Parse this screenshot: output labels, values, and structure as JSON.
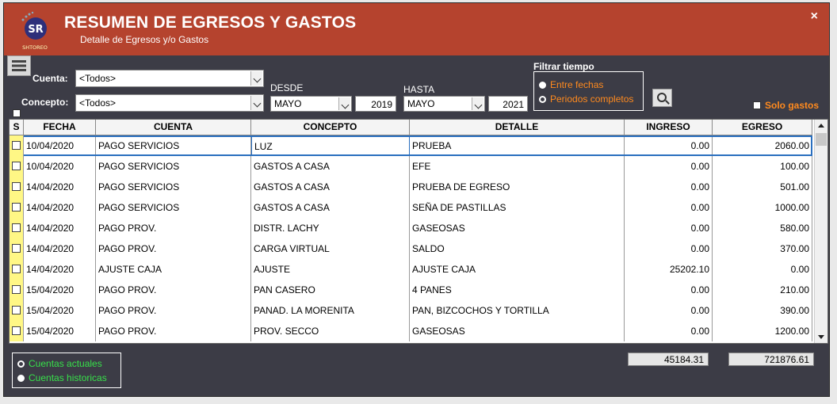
{
  "window": {
    "title": "RESUMEN DE EGRESOS Y GASTOS",
    "subtitle": "Detalle de Egresos y/o Gastos",
    "logo_text": "SR",
    "logo_brand": "SHTOREO",
    "close_label": "×",
    "accent_color": "#b5432e"
  },
  "filters": {
    "cuenta_label": "Cuenta:",
    "cuenta_value": "<Todos>",
    "concepto_label": "Concepto:",
    "concepto_value": "<Todos>",
    "desde_label": "DESDE",
    "desde_month": "MAYO",
    "desde_year": "2019",
    "hasta_label": "HASTA",
    "hasta_month": "MAYO",
    "hasta_year": "2021",
    "filtrar_title": "Filtrar tiempo",
    "entre_fechas": "Entre fechas",
    "periodos_completos": "Periodos completos",
    "solo_gastos": "Solo gastos"
  },
  "table": {
    "columns": [
      "S",
      "FECHA",
      "CUENTA",
      "CONCEPTO",
      "DETALLE",
      "INGRESO",
      "EGRESO"
    ],
    "rows": [
      {
        "fecha": "10/04/2020",
        "cuenta": "PAGO SERVICIOS",
        "concepto": "LUZ",
        "detalle": "PRUEBA",
        "ingreso": "0.00",
        "egreso": "2060.00"
      },
      {
        "fecha": "10/04/2020",
        "cuenta": "PAGO SERVICIOS",
        "concepto": "GASTOS A CASA",
        "detalle": "EFE",
        "ingreso": "0.00",
        "egreso": "100.00"
      },
      {
        "fecha": "14/04/2020",
        "cuenta": "PAGO SERVICIOS",
        "concepto": "GASTOS A CASA",
        "detalle": "PRUEBA DE EGRESO",
        "ingreso": "0.00",
        "egreso": "501.00"
      },
      {
        "fecha": "14/04/2020",
        "cuenta": "PAGO SERVICIOS",
        "concepto": "GASTOS A CASA",
        "detalle": "SEÑA DE PASTILLAS",
        "ingreso": "0.00",
        "egreso": "1000.00"
      },
      {
        "fecha": "14/04/2020",
        "cuenta": "PAGO PROV.",
        "concepto": "DISTR. LACHY",
        "detalle": "GASEOSAS",
        "ingreso": "0.00",
        "egreso": "580.00"
      },
      {
        "fecha": "14/04/2020",
        "cuenta": "PAGO PROV.",
        "concepto": "CARGA VIRTUAL",
        "detalle": "SALDO",
        "ingreso": "0.00",
        "egreso": "370.00"
      },
      {
        "fecha": "14/04/2020",
        "cuenta": "AJUSTE CAJA",
        "concepto": "AJUSTE",
        "detalle": "AJUSTE CAJA",
        "ingreso": "25202.10",
        "egreso": "0.00"
      },
      {
        "fecha": "15/04/2020",
        "cuenta": "PAGO PROV.",
        "concepto": "PAN CASERO",
        "detalle": "4 PANES",
        "ingreso": "0.00",
        "egreso": "210.00"
      },
      {
        "fecha": "15/04/2020",
        "cuenta": "PAGO PROV.",
        "concepto": "PANAD. LA MORENITA",
        "detalle": "PAN, BIZCOCHOS Y TORTILLA",
        "ingreso": "0.00",
        "egreso": "390.00"
      },
      {
        "fecha": "15/04/2020",
        "cuenta": "PAGO PROV.",
        "concepto": "PROV. SECCO",
        "detalle": "GASEOSAS",
        "ingreso": "0.00",
        "egreso": "1200.00"
      }
    ]
  },
  "footer": {
    "cuentas_actuales": "Cuentas actuales",
    "cuentas_historicas": "Cuentas historicas",
    "total_ingreso": "45184.31",
    "total_egreso": "721876.61"
  }
}
